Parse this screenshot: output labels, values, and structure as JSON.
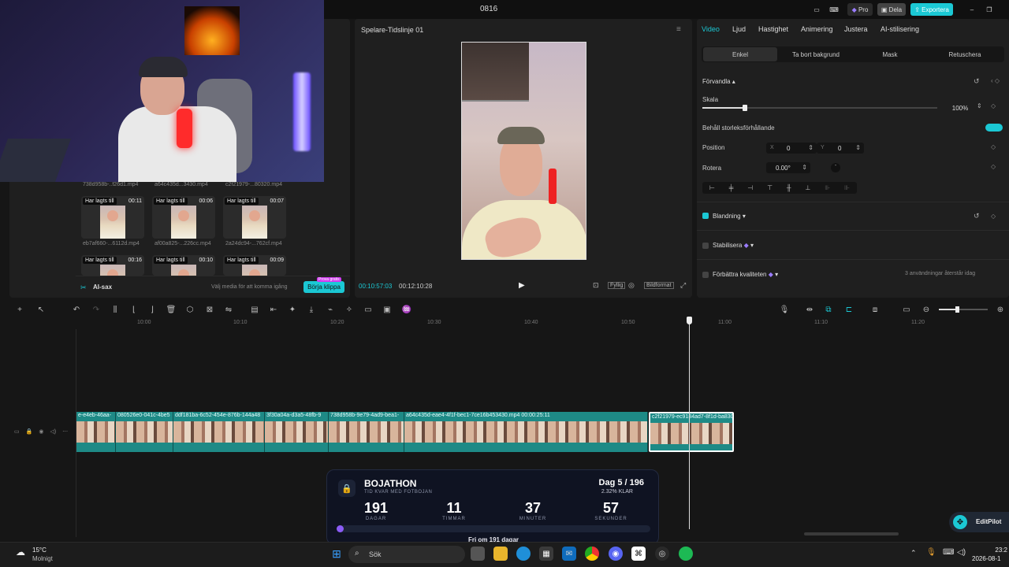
{
  "app": {
    "title": "0816",
    "pro_label": "Pro",
    "share_label": "Dela",
    "export_label": "Exportera"
  },
  "media": {
    "clips_row1": [
      "738d958b-..f26d1.mp4",
      "a64c435d...3430.mp4",
      "c2f21979-...80320.mp4"
    ],
    "clips_row2": [
      {
        "badge": "Har lagts till",
        "duration": "00:11",
        "name": "eb7af660-...6112d.mp4"
      },
      {
        "badge": "Har lagts till",
        "duration": "00:06",
        "name": "af00a825-...226cc.mp4"
      },
      {
        "badge": "Har lagts till",
        "duration": "00:07",
        "name": "2a24dc94-...762cf.mp4"
      }
    ],
    "clips_row3": [
      {
        "badge": "Har lagts till",
        "duration": "00:16"
      },
      {
        "badge": "Har lagts till",
        "duration": "00:10"
      },
      {
        "badge": "Har lagts till",
        "duration": "00:09"
      }
    ],
    "ai_cut_label": "AI-sax",
    "hint": "Välj media för att komma igång",
    "start_button": "Börja klippa",
    "free_badge": "Prova gratis"
  },
  "player": {
    "title": "Spelare-Tidslinje 01",
    "current_time": "00:10:57:03",
    "total_time": "00:12:10:28",
    "fill_label": "Fyllig",
    "ratio_label": "Bildformat"
  },
  "inspector": {
    "tabs": [
      "Video",
      "Ljud",
      "Hastighet",
      "Animering",
      "Justera",
      "AI-stilisering"
    ],
    "subtabs": [
      "Enkel",
      "Ta bort bakgrund",
      "Mask",
      "Retuschera"
    ],
    "transform_label": "Förvandla",
    "scale_label": "Skala",
    "scale_value": "100%",
    "scale_level": 0.18,
    "keep_ratio_label": "Behåll storleksförhållande",
    "position_label": "Position",
    "x_label": "X",
    "x_value": "0",
    "y_label": "Y",
    "y_value": "0",
    "rotate_label": "Rotera",
    "rotate_value": "0.00°",
    "blend_label": "Blandning",
    "stabilize_label": "Stabilisera",
    "enhance_label": "Förbättra kvaliteten",
    "enhance_note": "3 användningar återstår idag",
    "accent": "#1bc8d4"
  },
  "timeline": {
    "ruler": [
      "10:00",
      "10:10",
      "10:20",
      "10:30",
      "10:40",
      "10:50",
      "11:00",
      "11:10",
      "11:20"
    ],
    "clips": [
      "e-e4eb-46aa-",
      "080526e0-041c-4be5",
      "ddf181ba-6c52-454e-876b-144a48",
      "3f30a04a-d3a5-48fb-9",
      "738d958b-9e79-4ad9-bea1-",
      "a64c435d-eae4-4f1f-bec1-7ce16b453430.mp4  00:00:25:11",
      "c2f21979-ec9184ad7-8f1d-ba830"
    ]
  },
  "overlay": {
    "title": "BOJATHON",
    "subtitle": "TID KVAR MED FOTBOJAN",
    "day_label": "Dag 5 / 196",
    "progress_label": "2.32% KLAR",
    "progress": 0.0232,
    "days": "191",
    "days_label": "DAGAR",
    "hours": "11",
    "hours_label": "TIMMAR",
    "minutes": "37",
    "minutes_label": "MINUTER",
    "seconds": "57",
    "seconds_label": "SEKUNDER",
    "footer": "Fri om 191 dagar"
  },
  "editpilot": "EditPilot",
  "taskbar": {
    "temp": "15°C",
    "weather": "Molnigt",
    "search": "Sök",
    "time": "23:2",
    "date": "2026-08-1"
  }
}
